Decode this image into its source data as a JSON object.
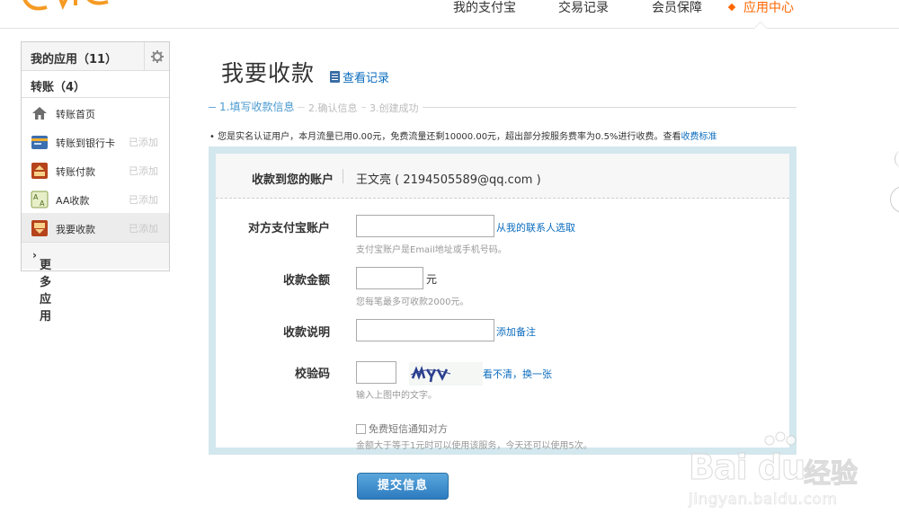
{
  "nav": {
    "items": [
      {
        "label": "我的支付宝"
      },
      {
        "label": "交易记录"
      },
      {
        "label": "会员保障"
      },
      {
        "label": "应用中心",
        "active": true
      }
    ],
    "accent_color": "#ff6600"
  },
  "sidebar": {
    "my_apps": "我的应用（11）",
    "group_title": "转账（4）",
    "items": [
      {
        "label": "转账首页",
        "state": "",
        "icon": "home-icon"
      },
      {
        "label": "转账到银行卡",
        "state": "已添加",
        "icon": "bank-card-icon"
      },
      {
        "label": "转账付款",
        "state": "已添加",
        "icon": "transfer-pay-icon"
      },
      {
        "label": "AA收款",
        "state": "已添加",
        "icon": "aa-collect-icon"
      },
      {
        "label": "我要收款",
        "state": "已添加",
        "icon": "collect-money-icon",
        "active": true
      }
    ],
    "more_apps": "更多应用"
  },
  "main": {
    "title": "我要收款",
    "view_records": "查看记录",
    "steps": [
      {
        "label": "1.填写收款信息",
        "active": true
      },
      {
        "label": "2.确认信息"
      },
      {
        "label": "3.创建成功"
      }
    ],
    "notice": {
      "text": "您是实名认证用户，本月流量已用0.00元，免费流量还剩10000.00元，超出部分按服务费率为0.5%进行收费。查看",
      "link": "收费标准"
    }
  },
  "form": {
    "account_label": "收款到您的账户",
    "account_value": "王文亮 ( 2194505589@qq.com )",
    "payer_label": "对方支付宝账户",
    "payer_value": "",
    "payer_link": "从我的联系人选取",
    "payer_hint": "支付宝账户是Email地址或手机号码。",
    "amount_label": "收款金额",
    "amount_value": "",
    "amount_unit": "元",
    "amount_hint": "您每笔最多可收款2000元。",
    "memo_label": "收款说明",
    "memo_value": "",
    "memo_link": "添加备注",
    "captcha_label": "校验码",
    "captcha_value": "",
    "captcha_refresh": "看不清，换一张",
    "captcha_hint": "输入上图中的文字。",
    "sms_label": "免费短信通知对方",
    "sms_checked": false,
    "sms_hint": "金额大于等于1元时可以使用该服务，今天还可以使用5次。",
    "submit": "提交信息"
  },
  "watermark": {
    "brand": "Bai du",
    "cn": "经验",
    "url": "jingyan.baidu.com"
  }
}
